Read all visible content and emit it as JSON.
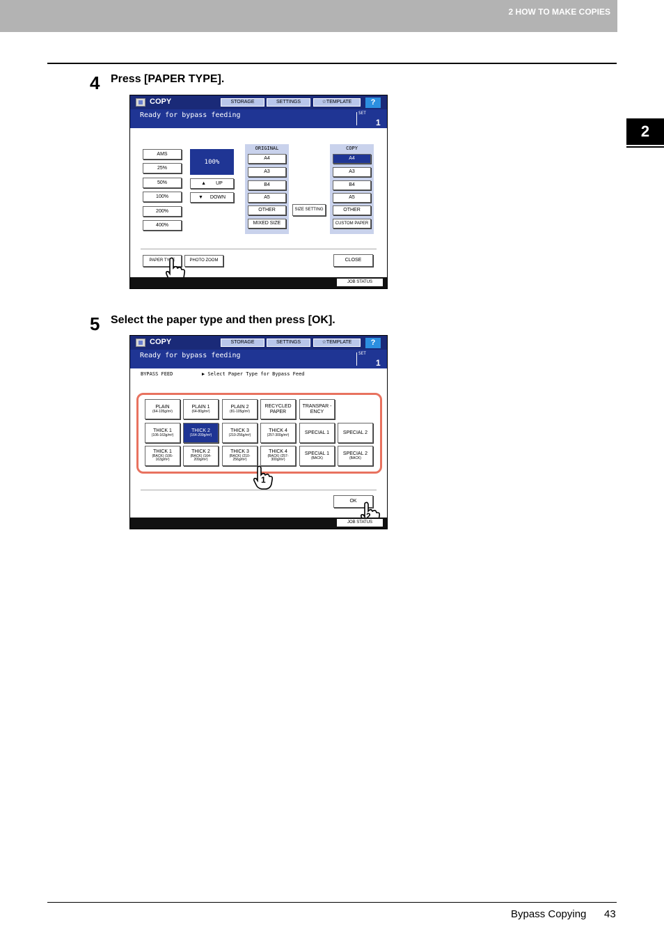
{
  "header": {
    "chapter": "2 HOW TO MAKE COPIES"
  },
  "chapter_tab": "2",
  "steps": [
    {
      "number": "4",
      "text": "Press [PAPER TYPE]."
    },
    {
      "number": "5",
      "text": "Select the paper type and then press [OK]."
    }
  ],
  "screen1": {
    "title": "COPY",
    "toolbar": {
      "storage": "STORAGE",
      "settings": "SETTINGS",
      "template": "TEMPLATE",
      "help": "?"
    },
    "status": "Ready for bypass feeding",
    "set_label": "SET",
    "set_value": "1",
    "zoom_buttons": [
      "AMS",
      "25%",
      "50%",
      "100%",
      "200%",
      "400%"
    ],
    "zoom_value": "100%",
    "up": "UP",
    "down": "DOWN",
    "original": {
      "title": "ORIGINAL",
      "items": [
        "A4",
        "A3",
        "B4",
        "A5",
        "OTHER",
        "MIXED SIZE"
      ]
    },
    "size_setting": "SIZE SETTING",
    "copy": {
      "title": "COPY",
      "items": [
        "A4",
        "A3",
        "B4",
        "A5",
        "OTHER",
        "CUSTOM PAPER"
      ]
    },
    "paper_type": "PAPER TYPE",
    "photo_zoom": "PHOTO ZOOM",
    "close": "CLOSE",
    "job_status": "JOB STATUS"
  },
  "screen2": {
    "title": "COPY",
    "toolbar": {
      "storage": "STORAGE",
      "settings": "SETTINGS",
      "template": "TEMPLATE",
      "help": "?"
    },
    "status": "Ready for bypass feeding",
    "set_label": "SET",
    "set_value": "1",
    "bypass_label": "BYPASS FEED",
    "instruction": "▶ Select Paper Type for Bypass Feed",
    "paper_buttons": [
      {
        "label": "PLAIN",
        "sub": "(64-105g/m²)"
      },
      {
        "label": "PLAIN 1",
        "sub": "(64-80g/m²)"
      },
      {
        "label": "PLAIN 2",
        "sub": "(81-105g/m²)"
      },
      {
        "label": "RECYCLED PAPER",
        "sub": ""
      },
      {
        "label": "TRANSPAR -ENCY",
        "sub": ""
      },
      {
        "label": "THICK 1",
        "sub": "(106-163g/m²)"
      },
      {
        "label": "THICK 2",
        "sub": "(164-209g/m²)"
      },
      {
        "label": "THICK 3",
        "sub": "(210-256g/m²)"
      },
      {
        "label": "THICK 4",
        "sub": "(257-300g/m²)"
      },
      {
        "label": "SPECIAL 1",
        "sub": ""
      },
      {
        "label": "SPECIAL 2",
        "sub": ""
      },
      {
        "label": "THICK 1",
        "sub": "(BACK) (106-163g/m²)"
      },
      {
        "label": "THICK 2",
        "sub": "(BACK) (164-209g/m²)"
      },
      {
        "label": "THICK 3",
        "sub": "(BACK) (210-256g/m²)"
      },
      {
        "label": "THICK 4",
        "sub": "(BACK) (257-300g/m²)"
      },
      {
        "label": "SPECIAL 1",
        "sub": "(BACK)"
      },
      {
        "label": "SPECIAL 2",
        "sub": "(BACK)"
      }
    ],
    "ok": "OK",
    "job_status": "JOB STATUS",
    "callout_1": "1",
    "callout_2": "2"
  },
  "footer": {
    "section": "Bypass Copying",
    "page": "43"
  }
}
